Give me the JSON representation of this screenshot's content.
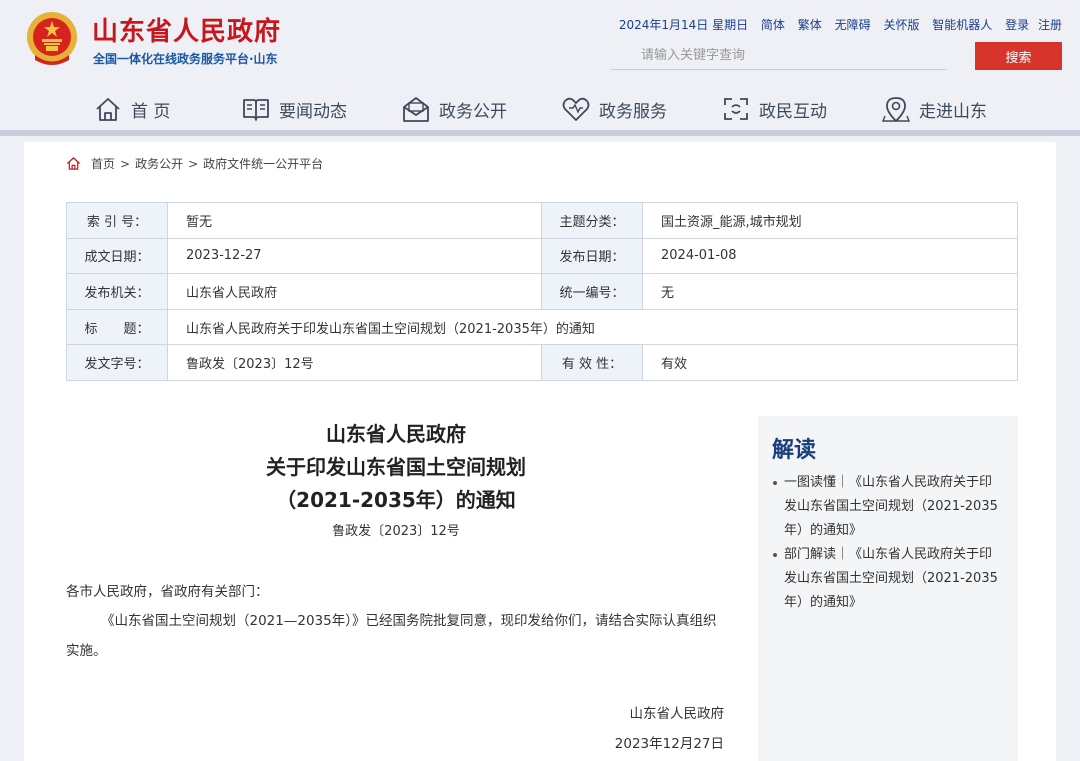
{
  "header": {
    "site_title": "山东省人民政府",
    "site_subtitle": "全国一体化在线政务服务平台·山东",
    "date": "2024年1月14日 星期日",
    "links": [
      "简体",
      "繁体",
      "无障碍",
      "关怀版",
      "智能机器人",
      "登录",
      "注册"
    ],
    "search_placeholder": "请输入关键字查询",
    "search_button": "搜索"
  },
  "nav": {
    "items": [
      {
        "label": "首 页",
        "icon": "home-icon"
      },
      {
        "label": "要闻动态",
        "icon": "news-book-icon"
      },
      {
        "label": "政务公开",
        "icon": "mail-open-icon"
      },
      {
        "label": "政务服务",
        "icon": "heart-icon"
      },
      {
        "label": "政民互动",
        "icon": "interaction-icon"
      },
      {
        "label": "走进山东",
        "icon": "location-pin-icon"
      }
    ]
  },
  "breadcrumb": {
    "items": [
      "首页",
      "政务公开",
      "政府文件统一公开平台"
    ],
    "separator": ">"
  },
  "meta": {
    "index_no_label": "索 引 号：",
    "index_no": "暂无",
    "topic_label": "主题分类：",
    "topic": "国土资源_能源,城市规划",
    "written_label": "成文日期：",
    "written": "2023-12-27",
    "published_label": "发布日期：",
    "published": "2024-01-08",
    "issuer_label": "发布机关：",
    "issuer": "山东省人民政府",
    "serial_label": "统一编号：",
    "serial": "无",
    "title_label": "标　　题：",
    "title": "山东省人民政府关于印发山东省国土空间规划（2021-2035年）的通知",
    "doc_no_label": "发文字号：",
    "doc_no": "鲁政发〔2023〕12号",
    "validity_label": "有 效 性：",
    "validity": "有效",
    "validity_color": "#e0452f"
  },
  "document": {
    "title_line1": "山东省人民政府",
    "title_line2": "关于印发山东省国土空间规划",
    "title_line3": "（2021-2035年）的通知",
    "doc_no": "鲁政发〔2023〕12号",
    "salutation": "各市人民政府，省政府有关部门：",
    "paragraph": "《山东省国土空间规划（2021—2035年）》已经国务院批复同意，现印发给你们，请结合实际认真组织实施。",
    "signature": "山东省人民政府",
    "sign_date": "2023年12月27日"
  },
  "sidebar": {
    "title": "解读",
    "items": [
      "一图读懂｜《山东省人民政府关于印发山东省国土空间规划（2021-2035年）的通知》",
      "部门解读｜《山东省人民政府关于印发山东省国土空间规划（2021-2035年）的通知》"
    ]
  },
  "colors": {
    "brand_red": "#c8161d",
    "nav_text": "#3d4a5c",
    "link_blue": "#1a3e8c",
    "search_button": "#d7342c",
    "sidebar_title": "#1a3f7e"
  }
}
